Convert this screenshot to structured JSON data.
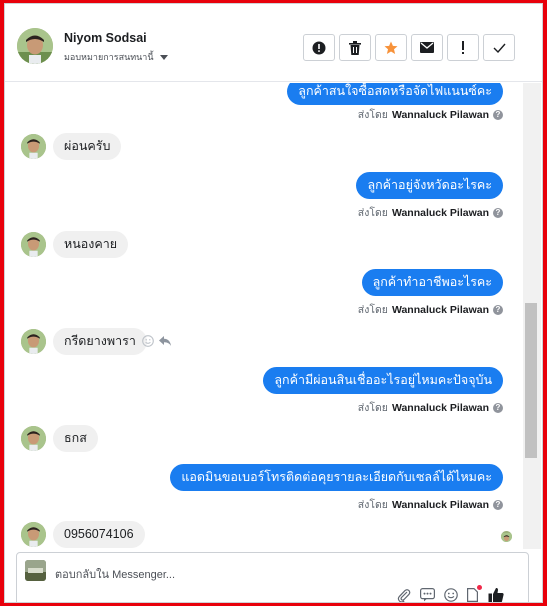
{
  "header": {
    "contact_name": "Niyom Sodsai",
    "assign_label": "มอบหมายการสนทนานี้"
  },
  "actions": [
    {
      "name": "spam-button",
      "icon": "alert-circle-icon"
    },
    {
      "name": "delete-button",
      "icon": "trash-icon"
    },
    {
      "name": "star-button",
      "icon": "star-icon"
    },
    {
      "name": "mark-unread-button",
      "icon": "envelope-icon"
    },
    {
      "name": "important-button",
      "icon": "exclamation-icon"
    },
    {
      "name": "done-button",
      "icon": "check-icon"
    }
  ],
  "messages": [
    {
      "direction": "out",
      "text": "ลูกค้าสนใจซื้อสดหรือจัดไฟแนนซ์คะ",
      "sent_by_prefix": "ส่งโดย",
      "sent_by": "Wannaluck Pilawan"
    },
    {
      "direction": "in",
      "text": "ผ่อนครับ"
    },
    {
      "direction": "out",
      "text": "ลูกค้าอยู่จังหวัดอะไรคะ",
      "sent_by_prefix": "ส่งโดย",
      "sent_by": "Wannaluck Pilawan"
    },
    {
      "direction": "in",
      "text": "หนองคาย"
    },
    {
      "direction": "out",
      "text": "ลูกค้าทำอาชีพอะไรคะ",
      "sent_by_prefix": "ส่งโดย",
      "sent_by": "Wannaluck Pilawan"
    },
    {
      "direction": "in",
      "text": "กรีดยางพารา"
    },
    {
      "direction": "out",
      "text": "ลูกค้ามีผ่อนสินเชื่ออะไรอยู่ไหมคะปัจจุบัน",
      "sent_by_prefix": "ส่งโดย",
      "sent_by": "Wannaluck Pilawan"
    },
    {
      "direction": "in",
      "text": "ธกส"
    },
    {
      "direction": "out",
      "text": "แอดมินขอเบอร์โทรติดต่อคุยรายละเอียดกับเซลล์ได้ไหมคะ",
      "sent_by_prefix": "ส่งโดย",
      "sent_by": "Wannaluck Pilawan"
    },
    {
      "direction": "in",
      "text": "0956074106"
    }
  ],
  "composer": {
    "placeholder": "ตอบกลับใน Messenger..."
  },
  "colors": {
    "frame": "#e8000b",
    "bubble_out": "#1a7df0",
    "bubble_in": "#f0f0f0",
    "star": "#f7923a"
  }
}
